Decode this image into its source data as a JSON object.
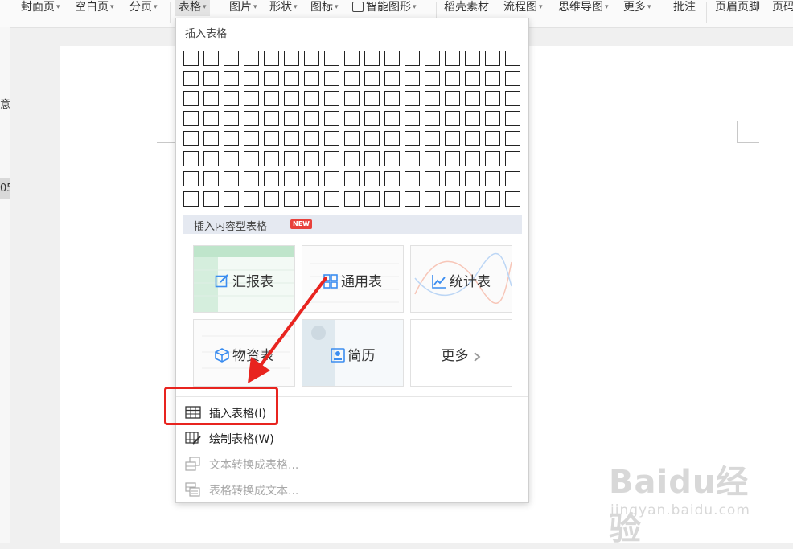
{
  "toolbar": {
    "items": [
      {
        "label": "封面页",
        "caret": "▾"
      },
      {
        "label": "空白页",
        "caret": "▾"
      },
      {
        "label": "分页",
        "caret": "▾"
      },
      {
        "label": "表格",
        "caret": "▾"
      },
      {
        "label": "图片",
        "caret": "▾"
      },
      {
        "label": "形状",
        "caret": "▾"
      },
      {
        "label": "图标",
        "caret": "▾"
      },
      {
        "label": "智能图形",
        "caret": "▾"
      },
      {
        "label": "稻壳素材"
      },
      {
        "label": "流程图",
        "caret": "▾"
      },
      {
        "label": "思维导图",
        "caret": "▾"
      },
      {
        "label": "更多",
        "caret": "▾"
      },
      {
        "label": "批注"
      },
      {
        "label": "页眉页脚"
      },
      {
        "label": "页码"
      }
    ]
  },
  "left_marks": [
    "意",
    "05"
  ],
  "dropdown": {
    "title": "插入表格",
    "grid": {
      "columns": 17,
      "rows": 8
    },
    "content_section": {
      "label": "插入内容型表格",
      "badge": "NEW"
    },
    "tiles": [
      {
        "label": "汇报表",
        "icon": "edit-icon",
        "color": "#3b8df0"
      },
      {
        "label": "通用表",
        "icon": "grid-icon",
        "color": "#3b8df0"
      },
      {
        "label": "统计表",
        "icon": "chart-line-icon",
        "color": "#3b8df0"
      },
      {
        "label": "物资表",
        "icon": "cube-icon",
        "color": "#3b8df0"
      },
      {
        "label": "简历",
        "icon": "person-card-icon",
        "color": "#3b8df0"
      },
      {
        "label": "更多",
        "icon": "chevron-right-icon",
        "color": "#999999"
      }
    ],
    "menu": [
      {
        "label": "插入表格(I)",
        "icon": "table-icon",
        "enabled": true
      },
      {
        "label": "绘制表格(W)",
        "icon": "draw-table-icon",
        "enabled": true
      },
      {
        "label": "文本转换成表格...",
        "icon": "text-to-table-icon",
        "enabled": false
      },
      {
        "label": "表格转换成文本...",
        "icon": "table-to-text-icon",
        "enabled": false
      }
    ]
  },
  "annotation": {
    "color": "#e8241f"
  },
  "watermark": {
    "text": "Baidu经验",
    "sub": "jingyan.baidu.com"
  }
}
